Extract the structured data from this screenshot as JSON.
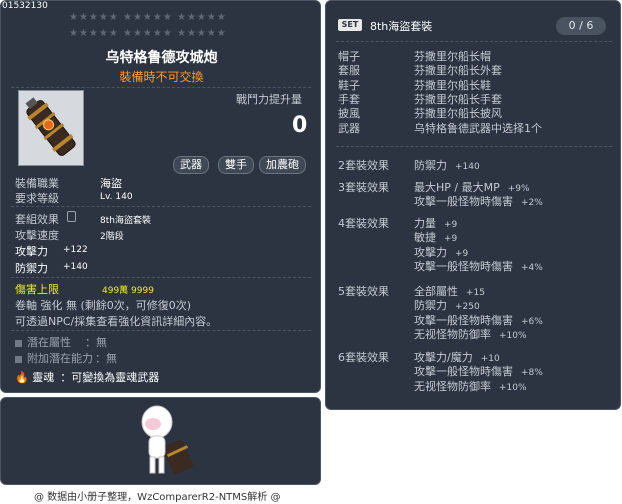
{
  "item_id": "01532130",
  "stars_row1": "★★★★★  ★★★★★  ★★★★★",
  "stars_row2": "★★★★★  ★★★★★  ★★★★★",
  "item_name": "乌特格鲁德攻城炮",
  "untradeable": "裝備時不可交換",
  "combat_power_label": "戰鬥力提升量",
  "combat_power_value": "0",
  "tags": [
    "武器",
    "雙手",
    "加農砲"
  ],
  "job_label": "裝備職業",
  "job_value": "海盜",
  "level_label": "要求等級",
  "level_value": "Lv. 140",
  "set_label": "套組效果",
  "set_value": "8th海盜套裝",
  "speed_label": "攻擊速度",
  "speed_value": "2階段",
  "atk_label": "攻擊力",
  "atk_value": "+122",
  "def_label": "防禦力",
  "def_value": "+140",
  "cap_label": "傷害上限",
  "cap_value": "499萬 9999",
  "scroll_line": "卷軸 強化 無 (剩餘0次，可修復0次)",
  "npc_line": "可透過NPC/採集查看強化資訊詳細內容。",
  "potential_label": "潛在屬性",
  "potential_value": "：無",
  "add_potential_label": "附加潛在能力",
  "add_potential_value": "：無",
  "soul_label": "靈魂",
  "soul_value": "：可變換為靈魂武器",
  "credit": "@ 数据由小册子整理，WzComparerR2-NTMS解析 @",
  "set_panel": {
    "badge": "SET",
    "name": "8th海盜套裝",
    "count": "0 / 6",
    "pieces": [
      {
        "slot": "帽子",
        "item": "芬撒里尔船长帽"
      },
      {
        "slot": "套服",
        "item": "芬撒里尔船长外套"
      },
      {
        "slot": "鞋子",
        "item": "芬撒里尔船长鞋"
      },
      {
        "slot": "手套",
        "item": "芬撒里尔船长手套"
      },
      {
        "slot": "披風",
        "item": "芬撒里尔船长披风"
      },
      {
        "slot": "武器",
        "item": "乌特格鲁德武器中选择1个"
      }
    ],
    "effects": [
      {
        "label": "2套裝效果",
        "lines": [
          [
            "防禦力",
            "+140"
          ]
        ]
      },
      {
        "label": "3套裝效果",
        "lines": [
          [
            "最大HP / 最大MP",
            "+9%"
          ],
          [
            "攻擊一般怪物時傷害",
            "+2%"
          ]
        ]
      },
      {
        "label": "4套裝效果",
        "lines": [
          [
            "力量",
            "+9"
          ],
          [
            "敏捷",
            "+9"
          ],
          [
            "攻擊力",
            "+9"
          ],
          [
            "攻擊一般怪物時傷害",
            "+4%"
          ]
        ]
      },
      {
        "label": "5套裝效果",
        "lines": [
          [
            "全部屬性",
            "+15"
          ],
          [
            "防禦力",
            "+250"
          ],
          [
            "攻擊一般怪物時傷害",
            "+6%"
          ],
          [
            "无视怪物防御率",
            "+10%"
          ]
        ]
      },
      {
        "label": "6套裝效果",
        "lines": [
          [
            "攻擊力/魔力",
            "+10"
          ],
          [
            "攻擊一般怪物時傷害",
            "+8%"
          ],
          [
            "无视怪物防御率",
            "+10%"
          ]
        ]
      }
    ]
  }
}
